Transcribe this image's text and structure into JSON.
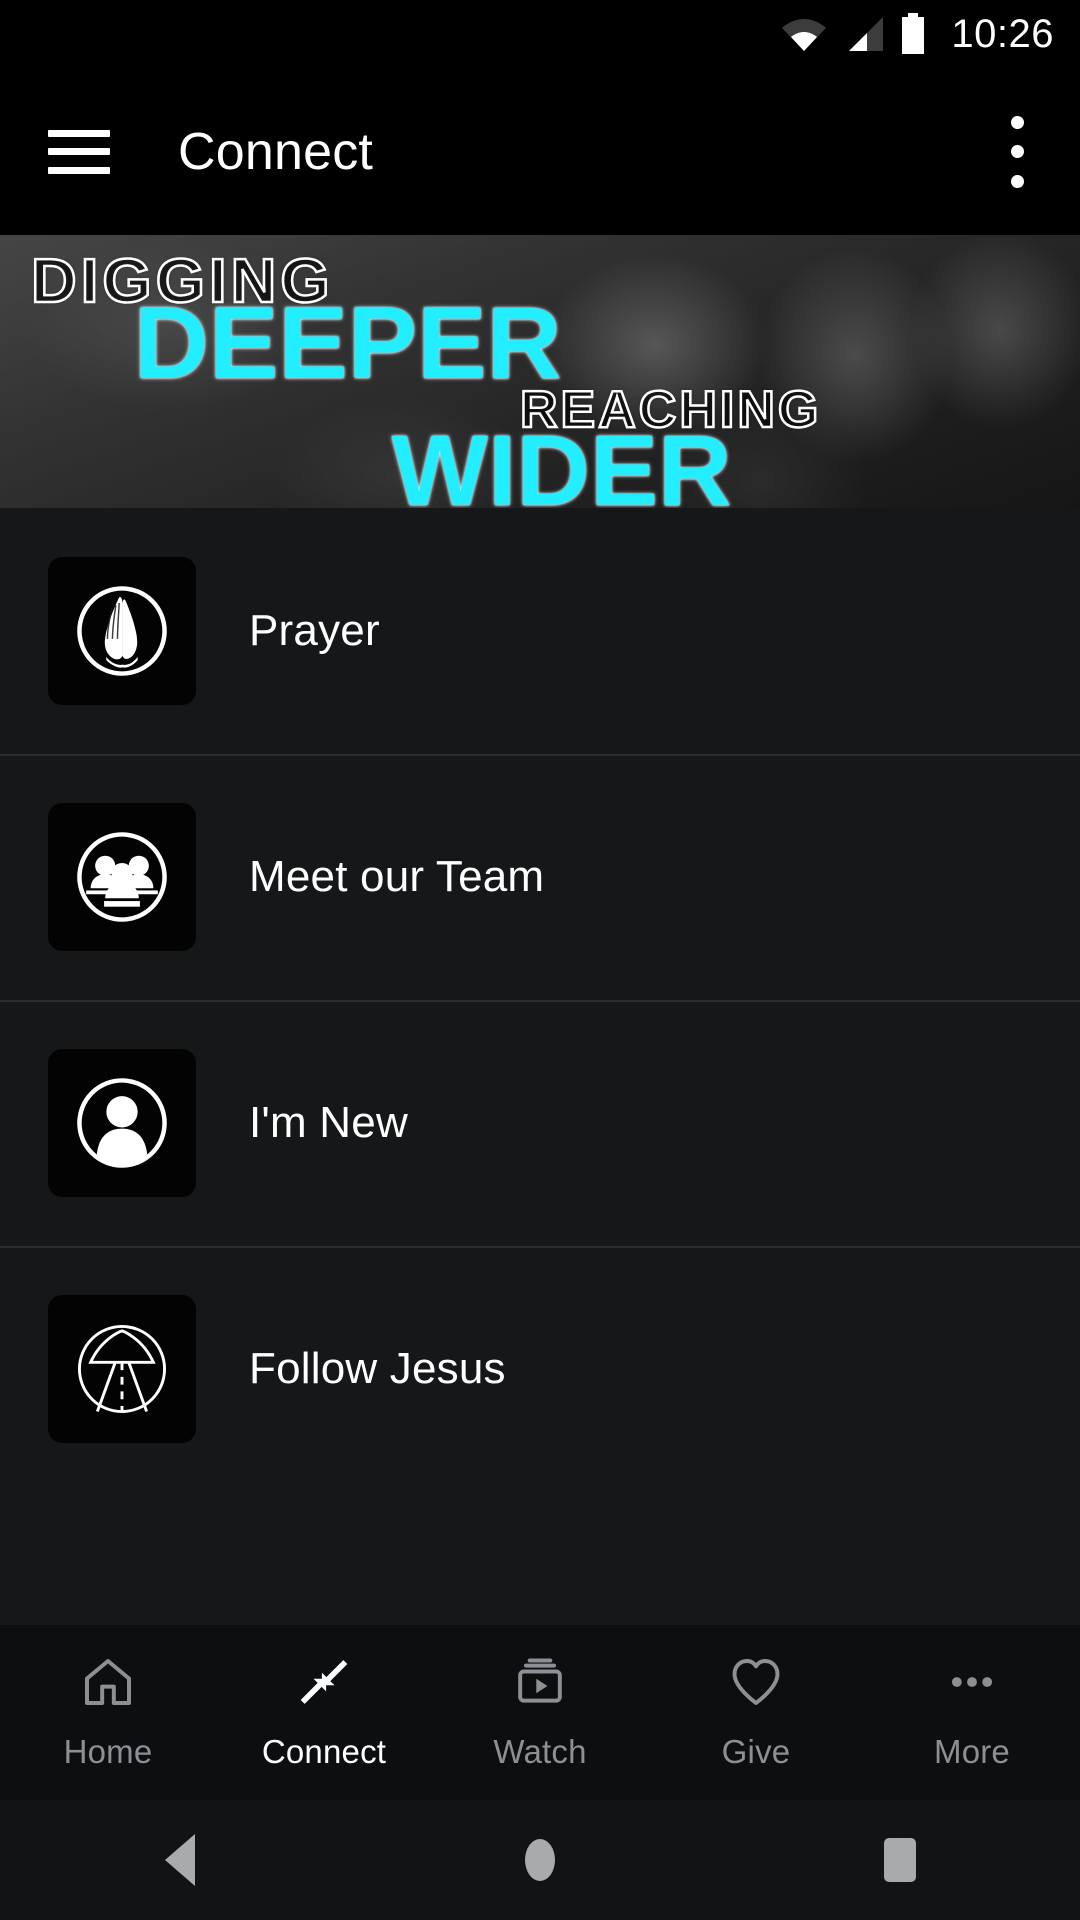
{
  "status_bar": {
    "time": "10:26",
    "icons": [
      "wifi-icon",
      "cellular-signal-icon",
      "battery-icon"
    ]
  },
  "app_bar": {
    "menu_icon": "hamburger-menu-icon",
    "title": "Connect",
    "overflow_icon": "overflow-menu-icon"
  },
  "banner": {
    "lines": [
      {
        "text": "DIGGING",
        "style": "outline"
      },
      {
        "text": "DEEPER",
        "style": "solid"
      },
      {
        "text": "REACHING",
        "style": "outline"
      },
      {
        "text": "WIDER",
        "style": "solid"
      }
    ],
    "accent_color": "#22EEFF",
    "outline_color": "#FFFFFF"
  },
  "list": {
    "items": [
      {
        "label": "Prayer",
        "icon": "praying-hands-icon"
      },
      {
        "label": "Meet our Team",
        "icon": "group-people-icon"
      },
      {
        "label": "I'm New",
        "icon": "person-icon"
      },
      {
        "label": "Follow Jesus",
        "icon": "road-path-icon"
      }
    ]
  },
  "tab_bar": {
    "active": "Connect",
    "tabs": [
      {
        "label": "Home",
        "icon": "home-icon",
        "active": false
      },
      {
        "label": "Connect",
        "icon": "connect-arrows-icon",
        "active": true
      },
      {
        "label": "Watch",
        "icon": "video-play-icon",
        "active": false
      },
      {
        "label": "Give",
        "icon": "heart-icon",
        "active": false
      },
      {
        "label": "More",
        "icon": "more-dots-icon",
        "active": false
      }
    ]
  },
  "system_nav": {
    "buttons": [
      {
        "name": "back-button",
        "icon": "triangle-back-icon"
      },
      {
        "name": "home-button",
        "icon": "circle-home-icon"
      },
      {
        "name": "recent-apps-button",
        "icon": "square-recents-icon"
      }
    ]
  }
}
